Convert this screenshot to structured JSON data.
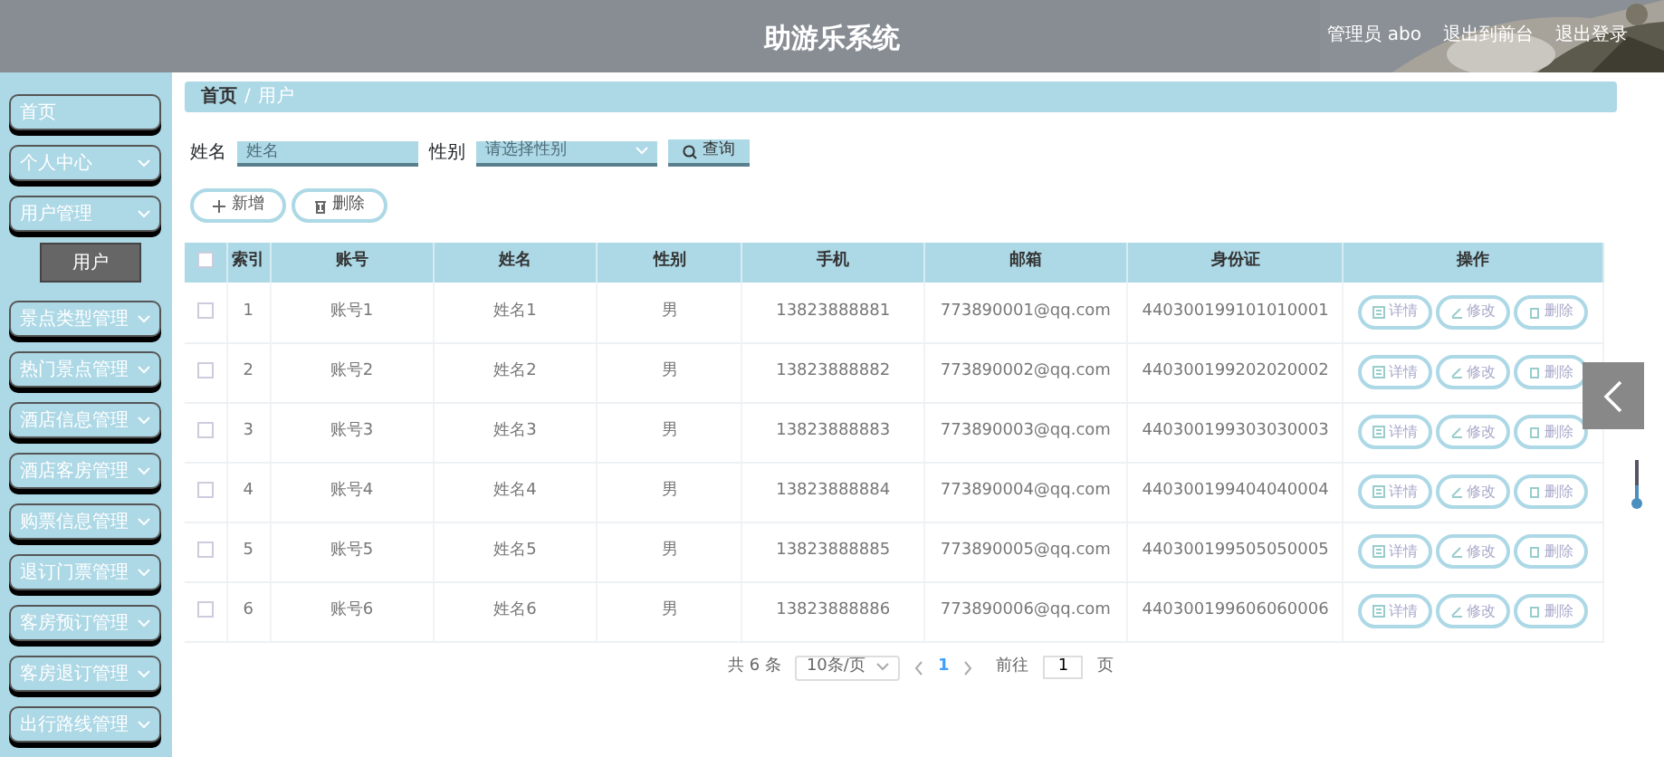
{
  "header": {
    "title": "助游乐系统",
    "links": [
      "管理员 abo",
      "退出到前台",
      "退出登录"
    ]
  },
  "sidebar": {
    "items": [
      {
        "label": "首页",
        "expandable": false
      },
      {
        "label": "个人中心",
        "expandable": true
      },
      {
        "label": "用户管理",
        "expandable": true,
        "children": [
          {
            "label": "用户"
          }
        ]
      },
      {
        "label": "景点类型管理",
        "expandable": true
      },
      {
        "label": "热门景点管理",
        "expandable": true
      },
      {
        "label": "酒店信息管理",
        "expandable": true
      },
      {
        "label": "酒店客房管理",
        "expandable": true
      },
      {
        "label": "购票信息管理",
        "expandable": true
      },
      {
        "label": "退订门票管理",
        "expandable": true
      },
      {
        "label": "客房预订管理",
        "expandable": true
      },
      {
        "label": "客房退订管理",
        "expandable": true
      },
      {
        "label": "出行路线管理",
        "expandable": true
      }
    ]
  },
  "breadcrumb": [
    "首页",
    "用户"
  ],
  "breadcrumb_separator": "/",
  "filters": [
    {
      "kind": "text",
      "label": "姓名",
      "placeholder": "姓名"
    },
    {
      "kind": "select",
      "label": "性别",
      "placeholder": "请选择性别"
    }
  ],
  "search_button": "查询",
  "actions": [
    "新增",
    "删除"
  ],
  "table": {
    "columns": [
      "索引",
      "账号",
      "姓名",
      "性别",
      "手机",
      "邮箱",
      "身份证",
      "操作"
    ],
    "header_checked": false,
    "rows": [
      {
        "checked": false,
        "cells": [
          "1",
          "账号1",
          "姓名1",
          "男",
          "13823888881",
          "773890001@qq.com",
          "440300199101010001"
        ],
        "actions": [
          "详情",
          "修改",
          "删除"
        ]
      },
      {
        "checked": false,
        "cells": [
          "2",
          "账号2",
          "姓名2",
          "男",
          "13823888882",
          "773890002@qq.com",
          "440300199202020002"
        ],
        "actions": [
          "详情",
          "修改",
          "删除"
        ]
      },
      {
        "checked": false,
        "cells": [
          "3",
          "账号3",
          "姓名3",
          "男",
          "13823888883",
          "773890003@qq.com",
          "440300199303030003"
        ],
        "actions": [
          "详情",
          "修改",
          "删除"
        ]
      },
      {
        "checked": false,
        "cells": [
          "4",
          "账号4",
          "姓名4",
          "男",
          "13823888884",
          "773890004@qq.com",
          "440300199404040004"
        ],
        "actions": [
          "详情",
          "修改",
          "删除"
        ]
      },
      {
        "checked": false,
        "cells": [
          "5",
          "账号5",
          "姓名5",
          "男",
          "13823888885",
          "773890005@qq.com",
          "440300199505050005"
        ],
        "actions": [
          "详情",
          "修改",
          "删除"
        ]
      },
      {
        "checked": false,
        "cells": [
          "6",
          "账号6",
          "姓名6",
          "男",
          "13823888886",
          "773890006@qq.com",
          "440300199606060006"
        ],
        "actions": [
          "详情",
          "修改",
          "删除"
        ]
      }
    ]
  },
  "pagination": {
    "total": "共 6 条",
    "page_size": "10条/页",
    "pages": [
      {
        "label": "1",
        "selected": true
      }
    ],
    "goto_label": "前往",
    "goto_value": "1",
    "goto_suffix": "页"
  }
}
